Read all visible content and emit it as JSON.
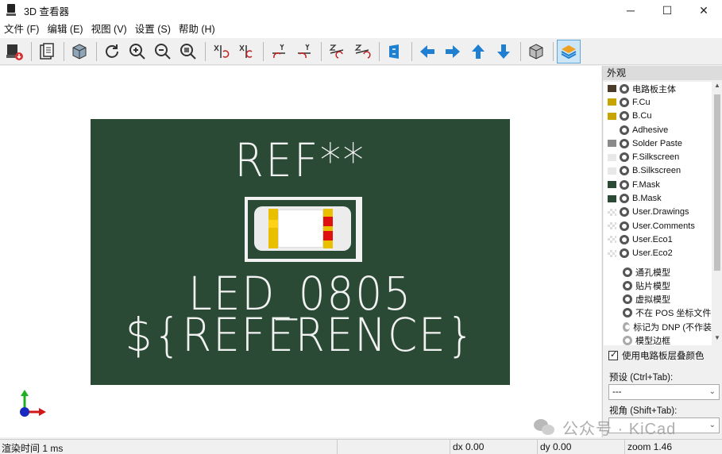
{
  "window": {
    "title": "3D 查看器",
    "minimize": "─",
    "maximize": "☐",
    "close": "✕"
  },
  "menu": [
    {
      "label": "文件 (F)"
    },
    {
      "label": "编辑 (E)"
    },
    {
      "label": "视图 (V)"
    },
    {
      "label": "设置 (S)"
    },
    {
      "label": "帮助 (H)"
    }
  ],
  "toolbar": {
    "buttons": [
      "export-image",
      "copy-to-clipboard",
      "show-3d-body",
      "reload",
      "zoom-in",
      "zoom-out",
      "zoom-fit",
      "rotate-x-cw",
      "rotate-x-ccw",
      "rotate-y-cw",
      "rotate-y-ccw",
      "rotate-z-cw",
      "rotate-z-ccw",
      "flip-board",
      "pan-left",
      "pan-right",
      "pan-up",
      "pan-down",
      "orthographic",
      "layers-manager"
    ],
    "active": "layers-manager",
    "accent_color": "#1f7fd0"
  },
  "board": {
    "ref_text": "REF**",
    "value_text": "LED_0805",
    "reference_text": "${REFERENCE}",
    "soldermask_color": "#2a4a36",
    "silkscreen_color": "#f2f2f2",
    "pad_color": "#e8c000",
    "cathode_color": "#e01010"
  },
  "appearance": {
    "header": "外观",
    "layers": [
      {
        "name": "电路板主体",
        "color": "#4a3a28",
        "visible": true
      },
      {
        "name": "F.Cu",
        "color": "#c8a400",
        "visible": true
      },
      {
        "name": "B.Cu",
        "color": "#c8a400",
        "visible": true
      },
      {
        "name": "Adhesive",
        "color": "",
        "visible": true
      },
      {
        "name": "Solder Paste",
        "color": "#8a8a8a",
        "visible": true
      },
      {
        "name": "F.Silkscreen",
        "color": "#e8e8e8",
        "visible": true
      },
      {
        "name": "B.Silkscreen",
        "color": "#e8e8e8",
        "visible": true
      },
      {
        "name": "F.Mask",
        "color": "#2a4a36",
        "visible": true
      },
      {
        "name": "B.Mask",
        "color": "#2a4a36",
        "visible": true
      },
      {
        "name": "User.Drawings",
        "color": "checker",
        "visible": true
      },
      {
        "name": "User.Comments",
        "color": "checker",
        "visible": true
      },
      {
        "name": "User.Eco1",
        "color": "checker",
        "visible": true
      },
      {
        "name": "User.Eco2",
        "color": "checker",
        "visible": true
      }
    ],
    "models": [
      {
        "name": "通孔模型",
        "visible": true
      },
      {
        "name": "贴片模型",
        "visible": true
      },
      {
        "name": "虚拟模型",
        "visible": true
      },
      {
        "name": "不在 POS 坐标文件",
        "visible": true
      },
      {
        "name": "标记为 DNP (不作装",
        "visible": false
      },
      {
        "name": "模型边框",
        "visible": false
      }
    ],
    "use_board_colors_label": "使用电路板层叠颜色",
    "use_board_colors": true,
    "preset_label": "预设 (Ctrl+Tab):",
    "preset_value": "---",
    "viewport_label": "视角 (Shift+Tab):",
    "viewport_value": ""
  },
  "status": {
    "render_time": "渲染时间 1 ms",
    "dx": "dx 0.00",
    "dy": "dy 0.00",
    "zoom": "zoom 1.46"
  },
  "watermark": "公众号 · KiCad"
}
